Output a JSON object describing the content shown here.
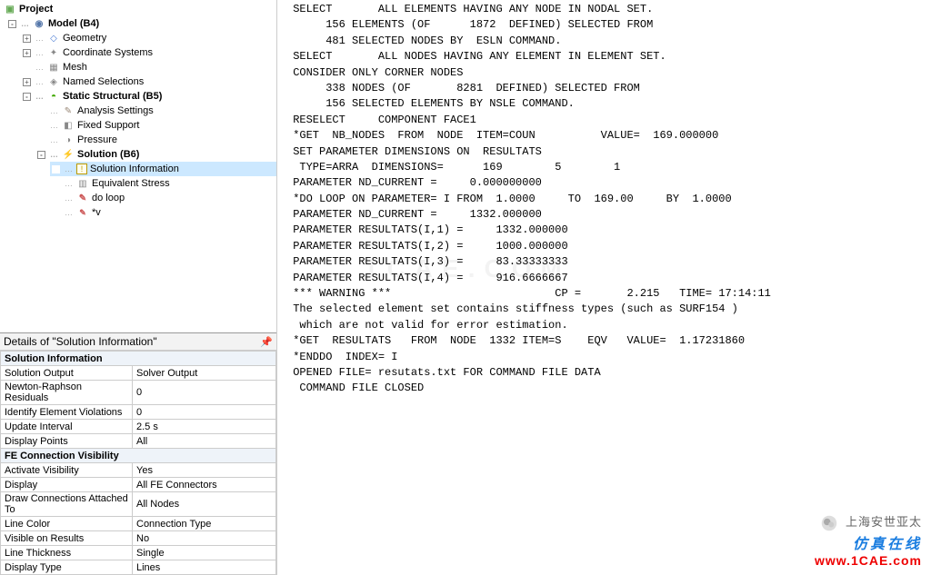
{
  "tree": {
    "title": "Project",
    "model": "Model (B4)",
    "geometry": "Geometry",
    "coord": "Coordinate Systems",
    "mesh": "Mesh",
    "named_sel": "Named Selections",
    "static": "Static Structural (B5)",
    "analysis": "Analysis Settings",
    "fixed": "Fixed Support",
    "pressure": "Pressure",
    "solution": "Solution (B6)",
    "sol_info": "Solution Information",
    "eq_stress": "Equivalent Stress",
    "do_loop": "do loop",
    "mv": "*v"
  },
  "details": {
    "title": "Details of \"Solution Information\"",
    "group1": "Solution Information",
    "rows1": [
      {
        "l": "Solution Output",
        "v": "Solver Output"
      },
      {
        "l": "Newton-Raphson Residuals",
        "v": "0"
      },
      {
        "l": "Identify Element Violations",
        "v": "0"
      },
      {
        "l": "Update Interval",
        "v": "2.5 s"
      },
      {
        "l": "Display Points",
        "v": "All"
      }
    ],
    "group2": "FE Connection Visibility",
    "rows2": [
      {
        "l": "Activate Visibility",
        "v": "Yes"
      },
      {
        "l": "Display",
        "v": "All FE Connectors"
      },
      {
        "l": "Draw Connections Attached To",
        "v": "All Nodes"
      },
      {
        "l": "Line Color",
        "v": "Connection Type"
      },
      {
        "l": "Visible on Results",
        "v": "No"
      },
      {
        "l": "Line Thickness",
        "v": "Single"
      },
      {
        "l": "Display Type",
        "v": "Lines"
      }
    ]
  },
  "output": {
    "l0": " SELECT       ALL ELEMENTS HAVING ANY NODE IN NODAL SET.",
    "l1": "",
    "l2": "      156 ELEMENTS (OF      1872  DEFINED) SELECTED FROM",
    "l3": "      481 SELECTED NODES BY  ESLN COMMAND.",
    "l4": "",
    "l5": " SELECT       ALL NODES HAVING ANY ELEMENT IN ELEMENT SET.",
    "l6": " CONSIDER ONLY CORNER NODES",
    "l7": "",
    "l8": "      338 NODES (OF       8281  DEFINED) SELECTED FROM",
    "l9": "      156 SELECTED ELEMENTS BY NSLE COMMAND.",
    "l10": "",
    "l11": " RESELECT     COMPONENT FACE1",
    "l12": "",
    "l13": " *GET  NB_NODES  FROM  NODE  ITEM=COUN          VALUE=  169.000000",
    "l14": "",
    "l15": " SET PARAMETER DIMENSIONS ON  RESULTATS",
    "l16": "  TYPE=ARRA  DIMENSIONS=      169        5        1",
    "l17": "",
    "l18": " PARAMETER ND_CURRENT =     0.000000000",
    "l19": "",
    "l20": " *DO LOOP ON PARAMETER= I FROM  1.0000     TO  169.00     BY  1.0000",
    "l21": "",
    "l22": " PARAMETER ND_CURRENT =     1332.000000",
    "l23": "",
    "l24": " PARAMETER RESULTATS(I,1) =     1332.000000",
    "l25": "",
    "l26": " PARAMETER RESULTATS(I,2) =     1000.000000",
    "l27": "",
    "l28": " PARAMETER RESULTATS(I,3) =     83.33333333",
    "l29": "",
    "l30": " PARAMETER RESULTATS(I,4) =     916.6666667",
    "l31": "",
    "l32": " *** WARNING ***                         CP =       2.215   TIME= 17:14:11",
    "l33": " The selected element set contains stiffness types (such as SURF154 )",
    "l34": "  which are not valid for error estimation.",
    "l35": "",
    "l36": " *GET  RESULTATS   FROM  NODE  1332 ITEM=S    EQV   VALUE=  1.17231860",
    "l37": "",
    "l38": " *ENDDO  INDEX= I",
    "l39": "",
    "l40": " OPENED FILE= resutats.txt FOR COMMAND FILE DATA",
    "l41": "",
    "l42": "",
    "l43": "  COMMAND FILE CLOSED"
  },
  "watermark": {
    "top": "上海安世亚太",
    "mid": "仿真在线",
    "url": "www.1CAE.com"
  },
  "center_wm": "1CAE.COM"
}
